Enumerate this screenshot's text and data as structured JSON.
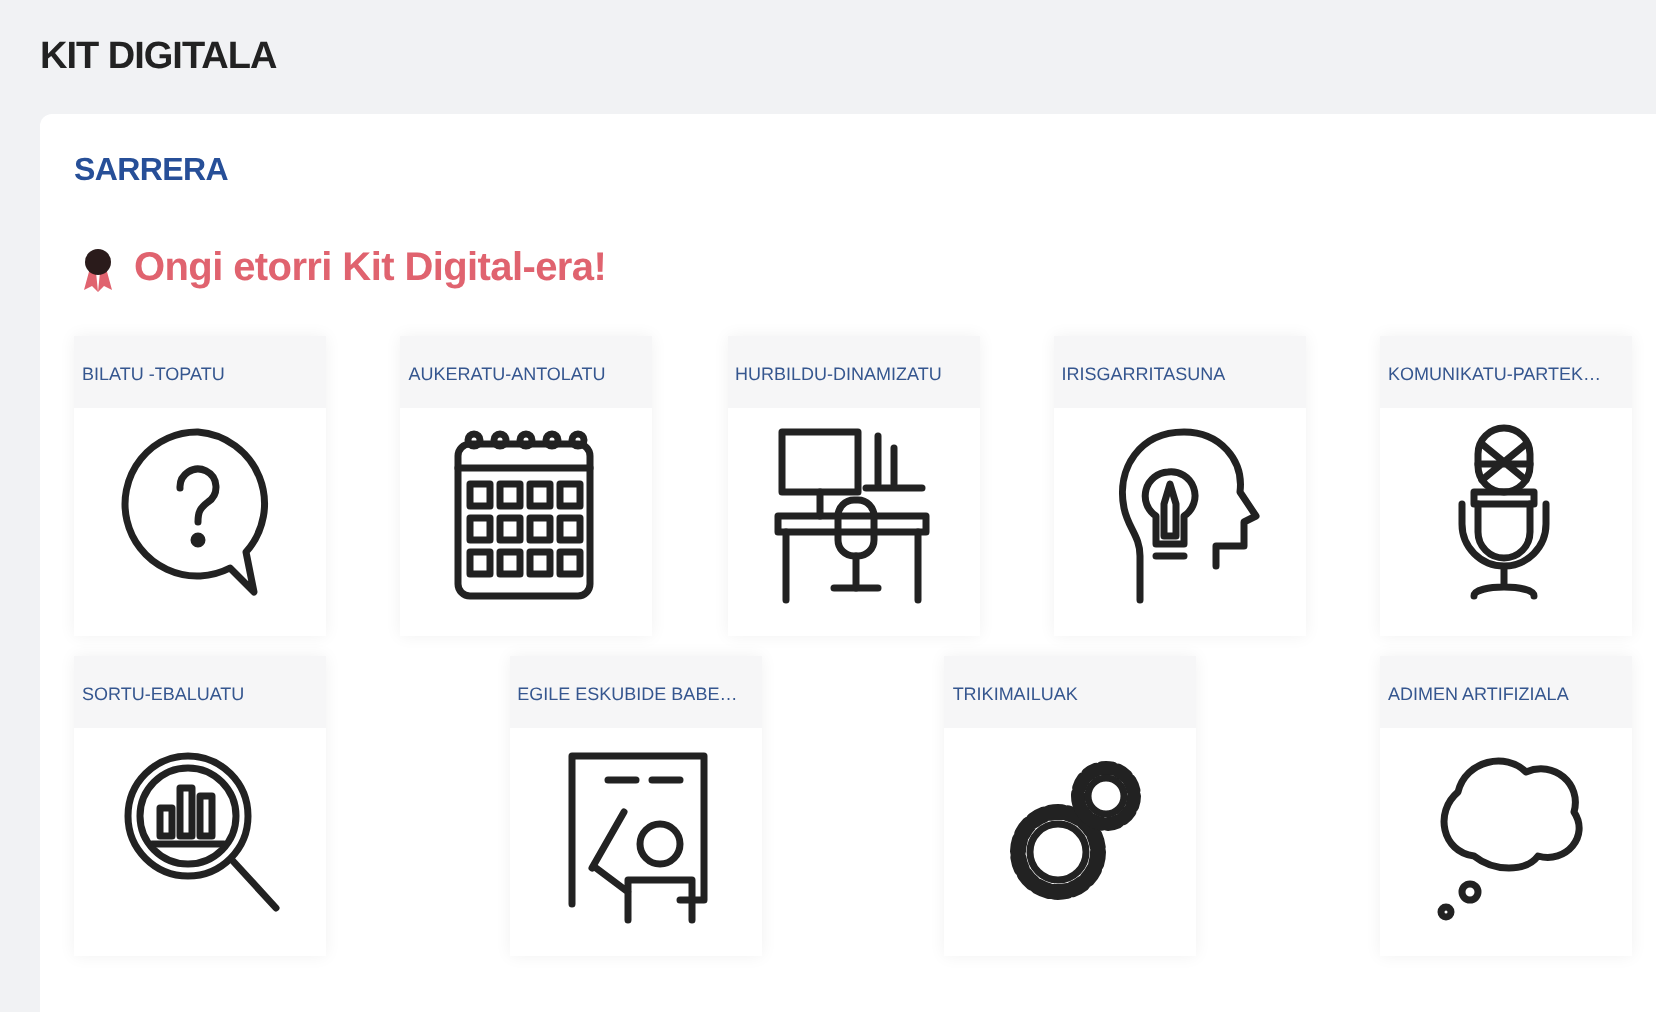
{
  "page": {
    "title": "KIT DIGITALA"
  },
  "section": {
    "title": "SARRERA",
    "welcome": "Ongi etorri Kit Digital-era!"
  },
  "tile_rows": [
    [
      {
        "label": "BILATU -TOPATU"
      },
      {
        "label": "AUKERATU-ANTOLATU"
      },
      {
        "label": "HURBILDU-DINAMIZATU"
      },
      {
        "label": "IRISGARRITASUNA"
      },
      {
        "label": "KOMUNIKATU-PARTEK…"
      }
    ],
    [
      {
        "label": "SORTU-EBALUATU"
      },
      {
        "label": "EGILE ESKUBIDE BABE…"
      },
      {
        "label": "TRIKIMAILUAK"
      },
      {
        "label": "ADIMEN ARTIFIZIALA"
      }
    ]
  ]
}
